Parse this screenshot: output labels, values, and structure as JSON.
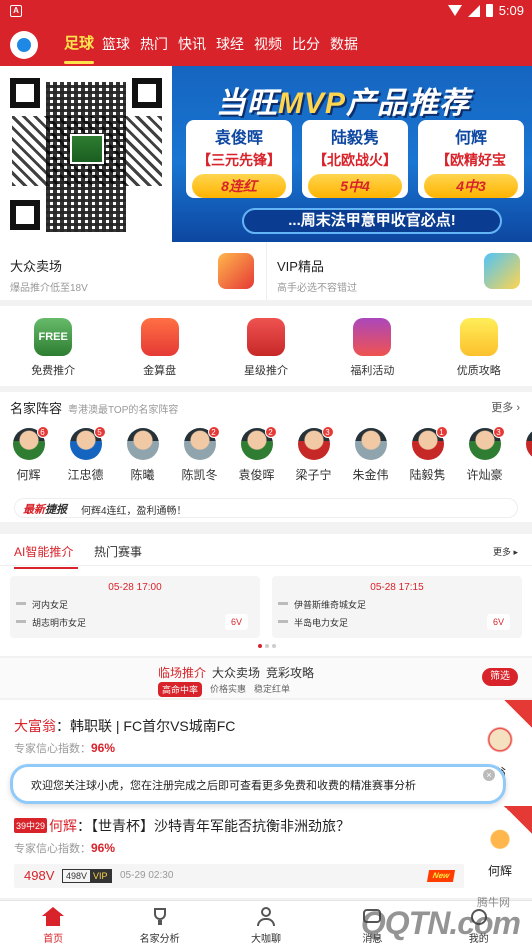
{
  "status_bar": {
    "notif_icon": "A",
    "time": "5:09"
  },
  "nav": {
    "tabs": [
      "足球",
      "篮球",
      "热门",
      "快讯",
      "球经",
      "视频",
      "比分",
      "数据"
    ],
    "active": 0
  },
  "banner": {
    "title_prefix": "当旺",
    "title_mvp": "MVP",
    "title_suffix": "产品推荐",
    "experts": [
      {
        "name": "袁俊晖",
        "tag": "【三元先锋】",
        "record": "8连红"
      },
      {
        "name": "陆毅隽",
        "tag": "【北欧战火】",
        "record": "5中4"
      },
      {
        "name": "何辉",
        "tag": "【欧精好宝",
        "record": "4中3"
      }
    ],
    "footer": "...周末法甲意甲收官必点!"
  },
  "dual": [
    {
      "title": "大众卖场",
      "subtitle": "爆品推介低至18V",
      "icon": "shop-icon"
    },
    {
      "title": "VIP精品",
      "subtitle": "高手必选不容错过",
      "icon": "vip-icon"
    }
  ],
  "quick": [
    {
      "label": "免费推介",
      "icon_text": "FREE"
    },
    {
      "label": "金算盘",
      "icon_text": ""
    },
    {
      "label": "星级推介",
      "icon_text": ""
    },
    {
      "label": "福利活动",
      "icon_text": ""
    },
    {
      "label": "优质攻略",
      "icon_text": ""
    }
  ],
  "experts_section": {
    "title": "名家阵容",
    "subtitle": "粤港澳最TOP的名家阵容",
    "more": "更多 ›",
    "people": [
      {
        "name": "何辉",
        "badge": "6"
      },
      {
        "name": "江忠德",
        "badge": "5"
      },
      {
        "name": "陈曦",
        "badge": ""
      },
      {
        "name": "陈凯冬",
        "badge": "2"
      },
      {
        "name": "袁俊晖",
        "badge": "2"
      },
      {
        "name": "梁子宁",
        "badge": "3"
      },
      {
        "name": "朱金伟",
        "badge": ""
      },
      {
        "name": "陆毅隽",
        "badge": "1"
      },
      {
        "name": "许灿豪",
        "badge": "3"
      },
      {
        "name": "...",
        "badge": ""
      }
    ],
    "ticker_tag_a": "最新",
    "ticker_tag_b": "捷报",
    "ticker_msg": "何辉4连红，盈利通畅！"
  },
  "ai": {
    "tab_ai": "AI智能推介",
    "tab_hot": "热门赛事",
    "more": "更多 ▸",
    "matches": [
      {
        "time": "05-28 17:00",
        "home": "河内女足",
        "away": "胡志明市女足",
        "odd": "6V"
      },
      {
        "time": "05-28 17:15",
        "home": "伊普斯维奇城女足",
        "away": "半岛电力女足",
        "odd": "6V"
      }
    ]
  },
  "feed_tabs": {
    "main": [
      "临场推介",
      "大众卖场",
      "竞彩攻略"
    ],
    "sub": [
      "高命中率",
      "价格实惠",
      "稳定红单"
    ],
    "filter": "筛选"
  },
  "posts": [
    {
      "author": "大富翁",
      "title": "韩职联 | FC首尔VS城南FC",
      "conf_label": "专家信心指数：",
      "conf_value": "96%",
      "side_name": "翁"
    },
    {
      "streak": "39中29",
      "author": "何辉",
      "title": "【世青杯】沙特青年军能否抗衡非洲劲旅？",
      "conf_label": "专家信心指数：",
      "conf_value": "96%",
      "price": "498V",
      "vip_price": "498V",
      "vip_label": "VIP",
      "time": "05-29 02:30",
      "new_tag": "New",
      "side_name": "何辉"
    }
  ],
  "toast": {
    "message": "欢迎您关注球小虎，您在注册完成之后即可查看更多免费和收费的精准赛事分析",
    "close": "×"
  },
  "tabbar": [
    {
      "label": "首页",
      "icon": "home-icon"
    },
    {
      "label": "名家分析",
      "icon": "trophy-icon"
    },
    {
      "label": "大咖聊",
      "icon": "chat-person-icon"
    },
    {
      "label": "消息",
      "icon": "message-icon"
    },
    {
      "label": "我的",
      "icon": "profile-icon"
    }
  ],
  "watermark": {
    "big": "QQTN.com",
    "small": "腾牛网"
  },
  "colors": {
    "primary": "#d8232a",
    "accent": "#ffe34d"
  }
}
